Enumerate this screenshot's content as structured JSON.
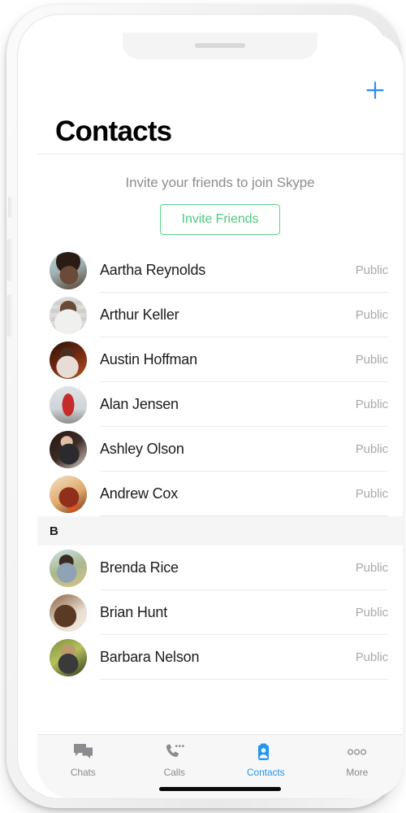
{
  "app": {
    "screen_title": "Contacts"
  },
  "nav": {
    "title": "Contacts",
    "add_icon": "plus-icon"
  },
  "invite": {
    "subtitle": "Invite your friends to join Skype",
    "button_label": "Invite Friends",
    "button_color": "#4fca7f",
    "button_border_color": "#5fd18c"
  },
  "colors": {
    "accent_blue": "#2196f3",
    "green": "#4fca7f",
    "status_text": "#a9a9ae",
    "section_bg": "#f5f5f5",
    "tab_bar_bg": "#f7f7f7"
  },
  "sections": [
    {
      "letter": "",
      "show_header": false,
      "contacts": [
        {
          "name": "Aartha Reynolds",
          "status": "Public",
          "avatar": "av0"
        },
        {
          "name": "Arthur Keller",
          "status": "Public",
          "avatar": "av1"
        },
        {
          "name": "Austin Hoffman",
          "status": "Public",
          "avatar": "av2"
        },
        {
          "name": "Alan Jensen",
          "status": "Public",
          "avatar": "av3"
        },
        {
          "name": "Ashley Olson",
          "status": "Public",
          "avatar": "av4"
        },
        {
          "name": "Andrew Cox",
          "status": "Public",
          "avatar": "av5"
        }
      ]
    },
    {
      "letter": "B",
      "show_header": true,
      "contacts": [
        {
          "name": "Brenda Rice",
          "status": "Public",
          "avatar": "av6"
        },
        {
          "name": "Brian Hunt",
          "status": "Public",
          "avatar": "av7"
        },
        {
          "name": "Barbara Nelson",
          "status": "Public",
          "avatar": "av8"
        }
      ]
    }
  ],
  "tabs": [
    {
      "label": "Chats",
      "icon": "chat-bubbles-icon",
      "active": false
    },
    {
      "label": "Calls",
      "icon": "phone-icon",
      "active": false
    },
    {
      "label": "Contacts",
      "icon": "contact-card-icon",
      "active": true
    },
    {
      "label": "More",
      "icon": "more-dots-icon",
      "active": false
    }
  ]
}
